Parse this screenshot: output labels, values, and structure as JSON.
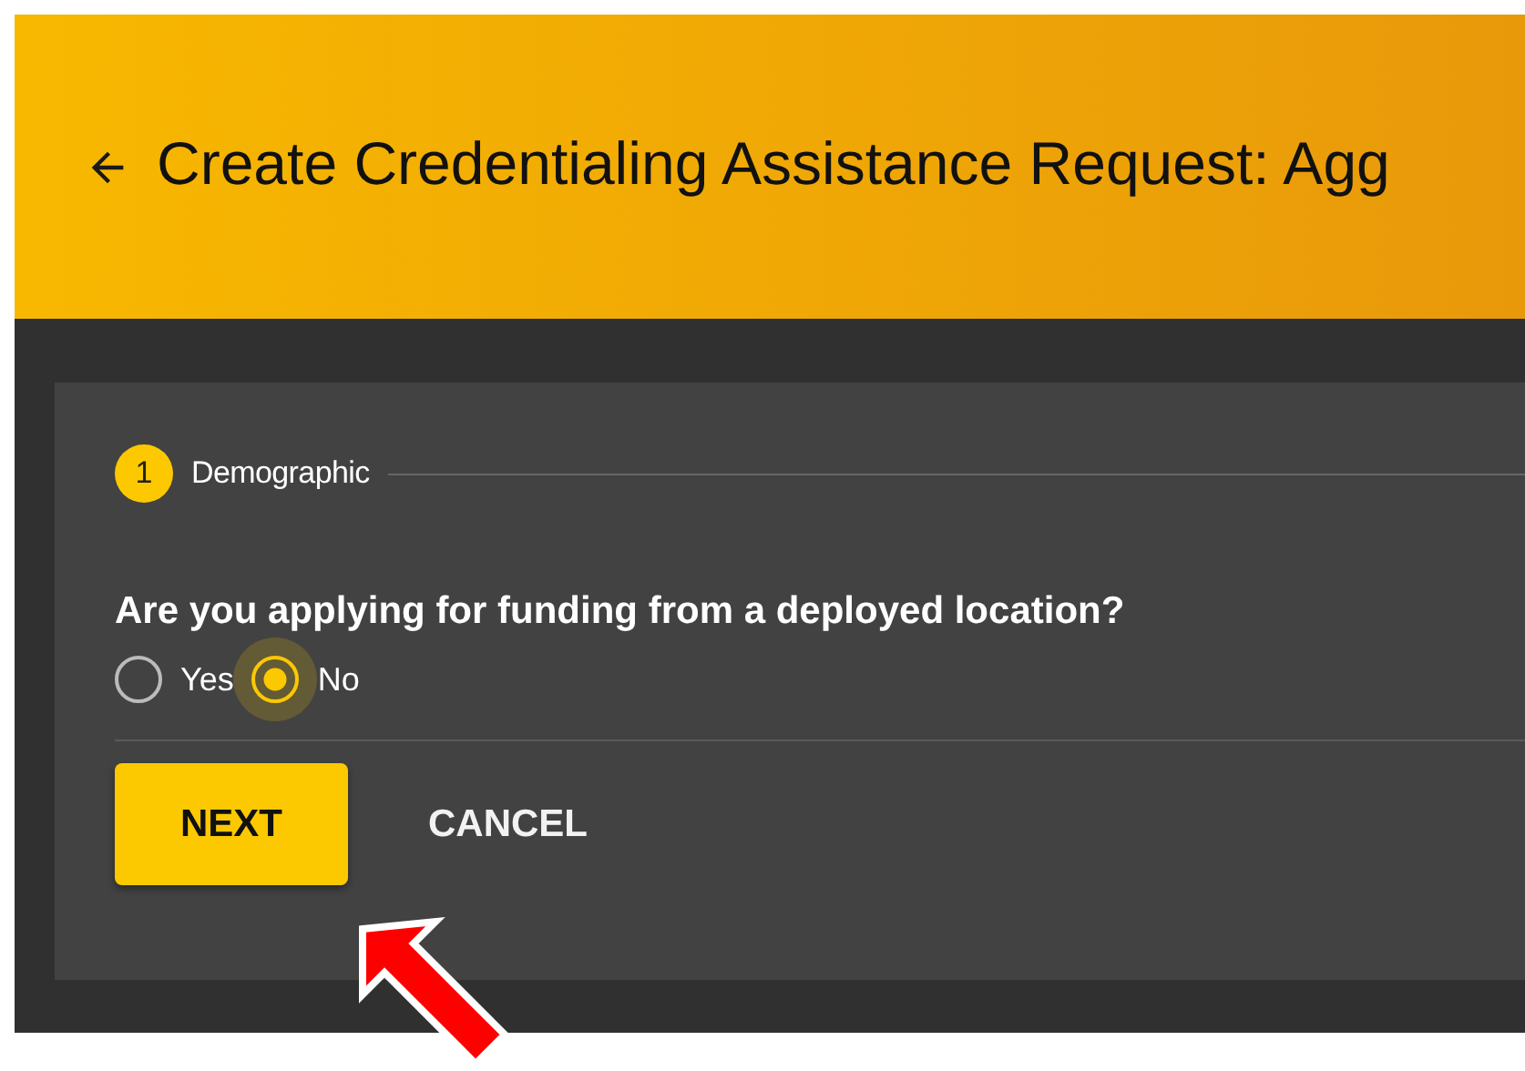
{
  "header": {
    "title": "Create Credentialing Assistance Request: Agg"
  },
  "stepper": {
    "steps": [
      {
        "number": "1",
        "label": "Demographic",
        "selected": true
      }
    ]
  },
  "question": {
    "label": "Are you applying for funding from a deployed location?",
    "options": [
      {
        "label": "Yes",
        "selected": false
      },
      {
        "label": "No",
        "selected": true
      }
    ]
  },
  "actions": [
    {
      "label": "NEXT",
      "kind": "primary"
    },
    {
      "label": "CANCEL",
      "kind": "text"
    }
  ]
}
